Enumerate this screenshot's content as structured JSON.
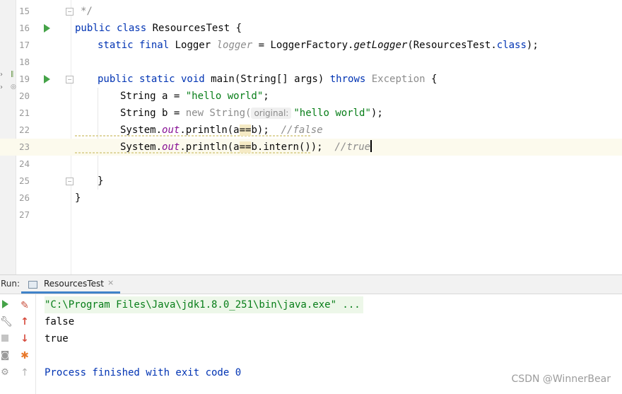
{
  "editor": {
    "lines": [
      {
        "n": "15"
      },
      {
        "n": "16"
      },
      {
        "n": "17"
      },
      {
        "n": "18"
      },
      {
        "n": "19"
      },
      {
        "n": "20"
      },
      {
        "n": "21"
      },
      {
        "n": "22"
      },
      {
        "n": "23"
      },
      {
        "n": "24"
      },
      {
        "n": "25"
      },
      {
        "n": "26"
      },
      {
        "n": "27"
      }
    ],
    "code": {
      "l15": "*/",
      "l16_kw": "public class",
      "l16_name": " ResourcesTest {",
      "l17_kw": "static final",
      "l17_type": " Logger ",
      "l17_field": "logger",
      "l17_eq": " = LoggerFactory.",
      "l17_call": "getLogger",
      "l17_arg": "(ResourcesTest.",
      "l17_kw2": "class",
      "l17_end": ");",
      "l19_kw": "public static void",
      "l19_sig": " main(String[] args) ",
      "l19_throws": "throws",
      "l19_exc": " Exception",
      "l19_brace": " {",
      "l20_decl": "String a = ",
      "l20_str": "\"hello world\"",
      "l20_end": ";",
      "l21_decl": "String b = ",
      "l21_new": "new String(",
      "l21_hint": "original:",
      "l21_str": "\"hello world\"",
      "l21_end": ");",
      "l22_sys": "System.",
      "l22_out": "out",
      "l22_call": ".println(",
      "l22_a": "a",
      "l22_op": "==",
      "l22_b": "b",
      "l22_end": ");  ",
      "l22_cmt": "//false",
      "l23_sys": "System.",
      "l23_out": "out",
      "l23_call": ".println(",
      "l23_a": "a",
      "l23_op": "==",
      "l23_b": "b.intern());  ",
      "l23_cmt": "//true",
      "l25": "}",
      "l26": "}"
    }
  },
  "run_panel": {
    "label": "Run:",
    "tab_label": "ResourcesTest",
    "tab_close": "×",
    "console": [
      "\"C:\\Program Files\\Java\\jdk1.8.0_251\\bin\\java.exe\" ...",
      "false",
      "true",
      "",
      "Process finished with exit code 0"
    ]
  },
  "watermark": "CSDN @WinnerBear",
  "colors": {
    "keyword": "#0033b3",
    "string": "#067d17",
    "field": "#871094",
    "comment": "#8c8c8c",
    "run_green": "#45a348",
    "tab_accent": "#4083c9"
  }
}
